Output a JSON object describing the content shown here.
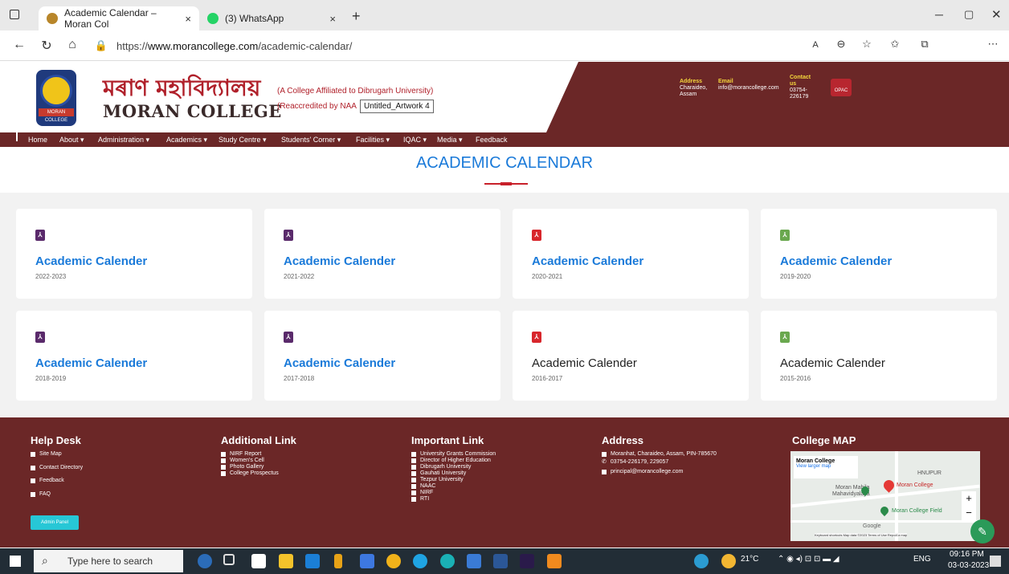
{
  "browser": {
    "tabs": [
      {
        "label": "Academic Calendar – Moran Col",
        "close": "×"
      },
      {
        "label": "(3) WhatsApp",
        "close": "×"
      }
    ],
    "new_tab": "+",
    "url_prefix": "https://",
    "url_domain": "www.morancollege.com",
    "url_path": "/academic-calendar/"
  },
  "header": {
    "title_assamese": "মৰাণ মহাবিদ্যালয়",
    "title_english": "MORAN COLLEGE",
    "affiliation": "(A College Affiliated to Dibrugarh University)",
    "reaccredited": "(Reaccredited by NAA",
    "tooltip": "Untitled_Artwork 4",
    "address_label": "Address",
    "address_value": "Charaideo, Assam",
    "email_label": "Email",
    "email_value": "info@morancollege.com",
    "contact_label": "Contact us",
    "contact_value": "03754-226179",
    "opac": "OPAC"
  },
  "nav": [
    "Home",
    "About ▾",
    "Administration ▾",
    "Academics ▾",
    "Study Centre ▾",
    "Students' Corner ▾",
    "Facilities ▾",
    "IQAC ▾",
    "Media ▾",
    "Feedback"
  ],
  "page": {
    "title": "ACADEMIC CALENDAR"
  },
  "cards": [
    {
      "title": "Academic Calender",
      "year": "2022-2023",
      "color": "#5a2a6b"
    },
    {
      "title": "Academic Calender",
      "year": "2021-2022",
      "color": "#5a2a6b"
    },
    {
      "title": "Academic Calender",
      "year": "2020-2021",
      "color": "#d8262c"
    },
    {
      "title": "Academic Calender",
      "year": "2019-2020",
      "color": "#6aa84f"
    },
    {
      "title": "Academic Calender",
      "year": "2018-2019",
      "color": "#5a2a6b"
    },
    {
      "title": "Academic Calender",
      "year": "2017-2018",
      "color": "#5a2a6b"
    },
    {
      "title": "Academic Calender",
      "year": "2016-2017",
      "color": "#d8262c"
    },
    {
      "title": "Academic Calender",
      "year": "2015-2016",
      "color": "#6aa84f"
    }
  ],
  "footer": {
    "help_desk": {
      "heading": "Help Desk",
      "links": [
        "Site Map",
        "Contact Directory",
        "Feedback",
        "FAQ"
      ],
      "admin": "Admin Panel"
    },
    "additional": {
      "heading": "Additional Link",
      "links": [
        "NIRF Report",
        "Women's Cell",
        "Photo Gallery",
        "College Prospectus"
      ]
    },
    "important": {
      "heading": "Important Link",
      "links": [
        "University Grants Commission",
        "Director of Higher Education",
        "Dibrugarh University",
        "Gauhati University",
        "Tezpur University",
        "NAAC",
        "NIRF",
        "RTI"
      ]
    },
    "address": {
      "heading": "Address",
      "lines": [
        "Moranhat, Charaideo, Assam, PIN-785670",
        "03754-226179, 229057",
        "principal@morancollege.com"
      ]
    },
    "map": {
      "heading": "College MAP",
      "place": "Moran College",
      "larger": "View larger map",
      "labels": [
        "Moran Mahila",
        "Mahavidyalaya",
        "Moran College",
        "Moran College Field",
        "HNUPUR",
        "Google"
      ],
      "credits": "Keyboard shortcuts   Map data ©2023   Terms of Use   Report a map"
    }
  },
  "taskbar": {
    "search_placeholder": "Type here to search",
    "temp": "21°C",
    "lang": "ENG",
    "time": "09:16 PM",
    "date": "03-03-2023"
  }
}
